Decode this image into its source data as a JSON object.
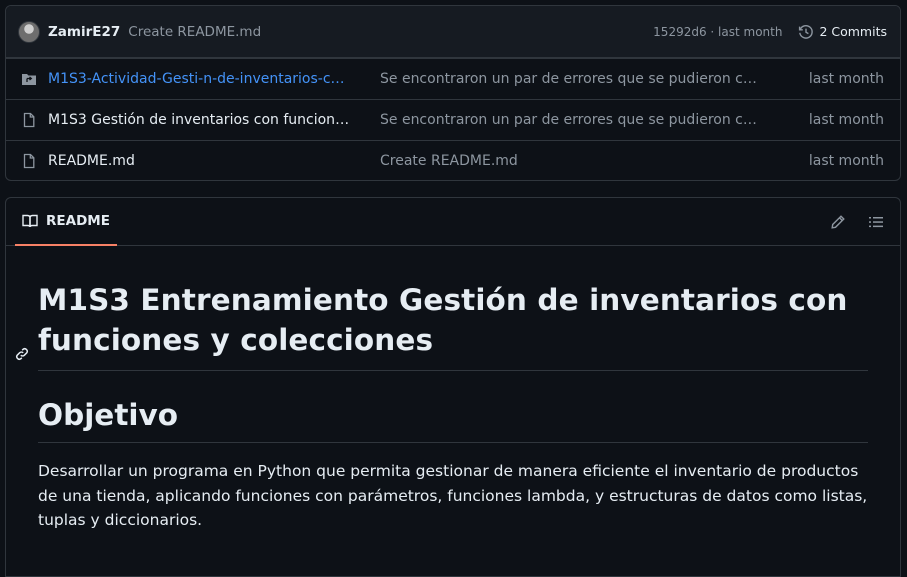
{
  "latest_commit": {
    "author": "ZamirE27",
    "message": "Create README.md",
    "meta": "15292d6 · last month",
    "commits_label": "2 Commits"
  },
  "files": [
    {
      "type": "folder-submodule",
      "name": "M1S3-Actividad-Gesti-n-de-inventarios-con-...",
      "message": "Se encontraron un par de errores que se pudieron corre...",
      "date": "last month"
    },
    {
      "type": "file",
      "name": "M1S3 Gestión de inventarios con funciones ...",
      "message": "Se encontraron un par de errores que se pudieron corre...",
      "date": "last month"
    },
    {
      "type": "file",
      "name": "README.md",
      "message": "Create README.md",
      "date": "last month"
    }
  ],
  "readme": {
    "tab_label": "README",
    "title": "M1S3 Entrenamiento Gestión de inventarios con funciones y colecciones",
    "objective_heading": "Objetivo",
    "objective_text": "Desarrollar un programa en Python que permita gestionar de manera eficiente el inventario de productos de una tienda, aplicando funciones con parámetros, funciones lambda, y estructuras de datos como listas, tuplas y diccionarios."
  },
  "colors": {
    "background": "#0d1117",
    "border": "#30363d",
    "link": "#4493f8",
    "muted": "#8d96a0",
    "tab_underline": "#f78166"
  }
}
